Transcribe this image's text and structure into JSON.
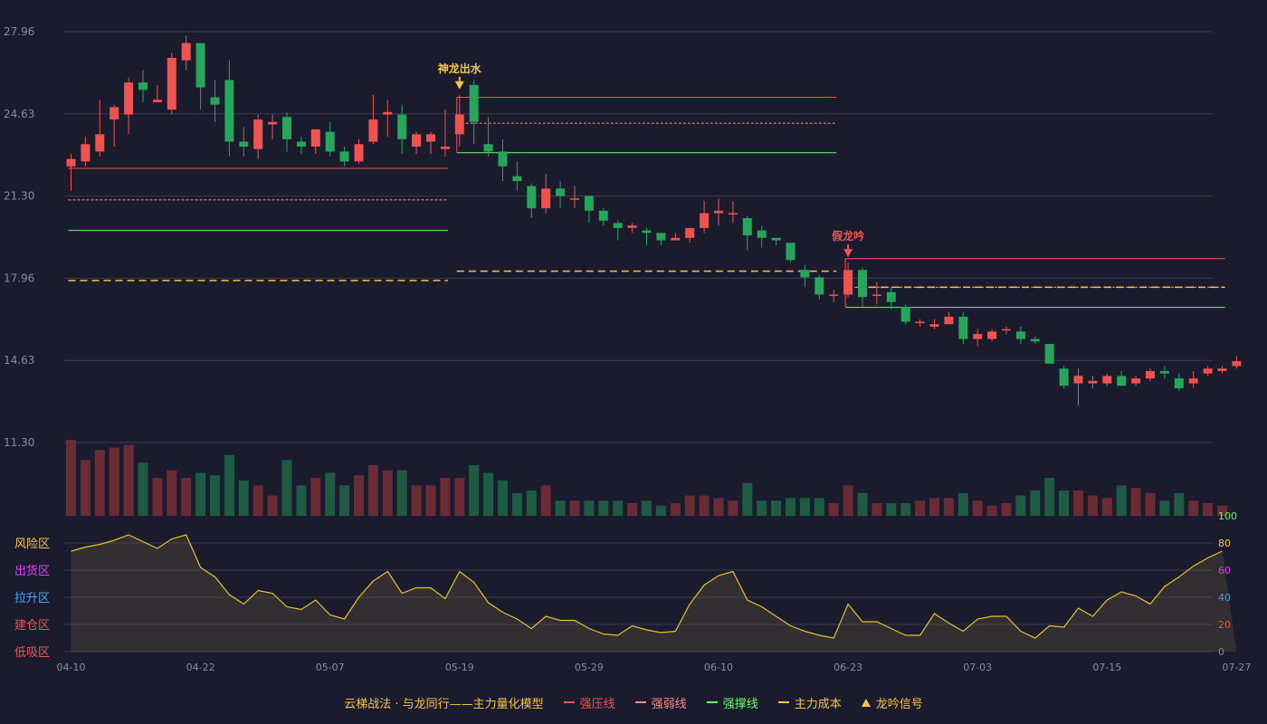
{
  "chart_data": {
    "type": "candlestick",
    "y_ticks": [
      "27.96",
      "24.63",
      "21.30",
      "17.96",
      "14.63",
      "11.30"
    ],
    "ylim": [
      11.3,
      27.96
    ],
    "x_ticks": [
      "04-10",
      "04-22",
      "05-07",
      "05-19",
      "05-29",
      "06-10",
      "06-23",
      "07-03",
      "07-15",
      "07-27"
    ],
    "candles": [
      [
        22.5,
        22.8,
        23.0,
        21.5
      ],
      [
        22.7,
        23.4,
        23.7,
        22.5
      ],
      [
        23.1,
        23.8,
        25.2,
        22.9
      ],
      [
        24.4,
        24.9,
        25.0,
        23.3
      ],
      [
        24.6,
        25.9,
        26.1,
        23.8
      ],
      [
        25.9,
        25.6,
        26.4,
        25.1
      ],
      [
        25.1,
        25.2,
        25.8,
        25.1
      ],
      [
        24.8,
        26.9,
        27.1,
        24.6
      ],
      [
        26.8,
        27.5,
        27.8,
        26.4
      ],
      [
        27.5,
        25.7,
        27.5,
        24.8
      ],
      [
        25.3,
        25.0,
        26.0,
        24.3
      ],
      [
        26.0,
        23.5,
        26.8,
        22.9
      ],
      [
        23.5,
        23.3,
        24.1,
        22.9
      ],
      [
        23.2,
        24.4,
        24.6,
        22.8
      ],
      [
        24.2,
        24.3,
        24.6,
        23.6
      ],
      [
        24.5,
        23.6,
        24.7,
        23.1
      ],
      [
        23.5,
        23.3,
        23.7,
        23.0
      ],
      [
        23.3,
        24.0,
        24.0,
        23.0
      ],
      [
        23.9,
        23.1,
        24.3,
        22.9
      ],
      [
        23.1,
        22.7,
        23.3,
        22.5
      ],
      [
        22.7,
        23.4,
        23.6,
        22.6
      ],
      [
        23.5,
        24.4,
        25.4,
        23.4
      ],
      [
        24.6,
        24.7,
        25.2,
        23.7
      ],
      [
        24.6,
        23.6,
        25.0,
        23.0
      ],
      [
        23.3,
        23.8,
        23.9,
        23.0
      ],
      [
        23.5,
        23.8,
        23.9,
        23.0
      ],
      [
        23.2,
        23.3,
        24.8,
        22.9
      ],
      [
        23.8,
        24.6,
        25.4,
        23.3
      ],
      [
        25.8,
        24.3,
        26.0,
        23.4
      ],
      [
        23.4,
        23.1,
        24.5,
        22.9
      ],
      [
        23.1,
        22.5,
        23.6,
        21.9
      ],
      [
        22.1,
        21.9,
        22.7,
        21.5
      ],
      [
        21.7,
        20.8,
        21.8,
        20.4
      ],
      [
        20.8,
        21.6,
        22.2,
        20.6
      ],
      [
        21.6,
        21.3,
        21.9,
        20.8
      ],
      [
        21.2,
        21.2,
        21.7,
        20.8
      ],
      [
        21.3,
        20.7,
        21.3,
        20.2
      ],
      [
        20.7,
        20.3,
        20.8,
        20.1
      ],
      [
        20.2,
        20.0,
        20.3,
        19.5
      ],
      [
        20.0,
        20.1,
        20.2,
        19.8
      ],
      [
        19.9,
        19.8,
        20.0,
        19.3
      ],
      [
        19.8,
        19.5,
        19.8,
        19.3
      ],
      [
        19.5,
        19.6,
        19.8,
        19.5
      ],
      [
        19.6,
        20.0,
        20.0,
        19.4
      ],
      [
        20.0,
        20.6,
        21.1,
        19.8
      ],
      [
        20.6,
        20.7,
        21.2,
        20.1
      ],
      [
        20.6,
        20.6,
        21.1,
        20.2
      ],
      [
        20.4,
        19.7,
        20.5,
        19.1
      ],
      [
        19.9,
        19.6,
        20.1,
        19.2
      ],
      [
        19.6,
        19.5,
        19.6,
        19.3
      ],
      [
        19.4,
        18.7,
        19.4,
        18.6
      ],
      [
        18.3,
        18.0,
        18.5,
        17.6
      ],
      [
        18.0,
        17.3,
        18.1,
        17.1
      ],
      [
        17.3,
        17.3,
        17.5,
        17.0
      ],
      [
        17.3,
        18.3,
        18.6,
        17.2
      ],
      [
        18.3,
        17.2,
        18.4,
        16.8
      ],
      [
        17.3,
        17.3,
        17.8,
        16.9
      ],
      [
        17.4,
        17.0,
        17.6,
        16.7
      ],
      [
        16.8,
        16.2,
        16.9,
        16.1
      ],
      [
        16.2,
        16.2,
        16.3,
        16.0
      ],
      [
        16.0,
        16.1,
        16.3,
        15.9
      ],
      [
        16.1,
        16.4,
        16.6,
        16.1
      ],
      [
        16.4,
        15.5,
        16.6,
        15.3
      ],
      [
        15.5,
        15.7,
        15.9,
        15.2
      ],
      [
        15.5,
        15.8,
        15.9,
        15.4
      ],
      [
        15.9,
        15.9,
        16.0,
        15.7
      ],
      [
        15.8,
        15.5,
        16.0,
        15.3
      ],
      [
        15.5,
        15.4,
        15.6,
        15.3
      ],
      [
        15.3,
        14.5,
        15.3,
        14.5
      ],
      [
        14.3,
        13.6,
        14.4,
        13.5
      ],
      [
        13.7,
        14.0,
        14.3,
        12.8
      ],
      [
        13.7,
        13.8,
        14.0,
        13.5
      ],
      [
        13.7,
        14.0,
        14.1,
        13.6
      ],
      [
        14.0,
        13.6,
        14.2,
        13.6
      ],
      [
        13.7,
        13.9,
        14.0,
        13.6
      ],
      [
        13.9,
        14.2,
        14.3,
        13.8
      ],
      [
        14.2,
        14.1,
        14.4,
        13.9
      ],
      [
        13.9,
        13.5,
        14.1,
        13.4
      ],
      [
        13.7,
        13.9,
        14.2,
        13.5
      ],
      [
        14.1,
        14.3,
        14.4,
        14.0
      ],
      [
        14.2,
        14.3,
        14.4,
        14.1
      ],
      [
        14.4,
        14.6,
        14.8,
        14.3
      ]
    ],
    "volumes": [
      30,
      22,
      26,
      27,
      28,
      21,
      15,
      18,
      15,
      17,
      16,
      24,
      14,
      12,
      8,
      22,
      12,
      15,
      17,
      12,
      16,
      20,
      18,
      18,
      12,
      12,
      15,
      15,
      20,
      17,
      14,
      9,
      10,
      12,
      6,
      6,
      6,
      6,
      6,
      5,
      6,
      4,
      5,
      8,
      8,
      7,
      6,
      13,
      6,
      6,
      7,
      7,
      7,
      5,
      12,
      9,
      5,
      5,
      5,
      6,
      7,
      7,
      9,
      6,
      4,
      5,
      8,
      10,
      15,
      10,
      10,
      8,
      7,
      12,
      11,
      9,
      6,
      9,
      6,
      5,
      4
    ],
    "indicator": [
      74,
      77,
      79,
      82,
      86,
      81,
      76,
      83,
      86,
      62,
      55,
      42,
      35,
      45,
      43,
      33,
      31,
      38,
      27,
      24,
      40,
      52,
      59,
      43,
      47,
      47,
      39,
      59,
      51,
      36,
      29,
      24,
      17,
      26,
      23,
      23,
      17,
      13,
      12,
      19,
      16,
      14,
      15,
      35,
      49,
      56,
      59,
      38,
      33,
      26,
      19,
      15,
      12,
      10,
      35,
      22,
      22,
      17,
      12,
      12,
      28,
      21,
      15,
      24,
      26,
      26,
      15,
      10,
      19,
      18,
      32,
      26,
      38,
      44,
      41,
      35,
      48,
      55,
      63,
      69,
      74
    ],
    "indicator_ticks": [
      "100",
      "80",
      "60",
      "40",
      "20",
      "0"
    ],
    "indicator_zones": [
      "风险区",
      "出货区",
      "拉升区",
      "建仓区",
      "低吸区"
    ],
    "annotations": [
      {
        "label": "神龙出水",
        "index": 27,
        "color": "#f5c542"
      },
      {
        "label": "假龙吟",
        "index": 54,
        "color": "#ef5350"
      }
    ],
    "levels": [
      {
        "from": 0,
        "to": 26,
        "resistance": 22.42,
        "weak": 21.14,
        "support": 19.9,
        "cost": 17.87
      },
      {
        "from": 27,
        "to": 53,
        "resistance": 25.3,
        "weak": 24.25,
        "support": 23.05,
        "cost": 18.25
      },
      {
        "from": 54,
        "to": 80,
        "resistance": 18.76,
        "weak": 17.6,
        "support": 16.78,
        "cost": 17.6
      }
    ],
    "legend": [
      {
        "label": "强压线",
        "color": "#ef5350",
        "style": "solid"
      },
      {
        "label": "强弱线",
        "color": "#ff8a8a",
        "style": "dash"
      },
      {
        "label": "强撑线",
        "color": "#66ff66",
        "style": "solid"
      },
      {
        "label": "主力成本",
        "color": "#f5c542",
        "style": "dash"
      },
      {
        "label": "龙吟信号",
        "color": "#f5c542",
        "style": "triangle"
      }
    ],
    "colors": {
      "up": "#ef5350",
      "down": "#26a65b",
      "grid": "#3a3a50",
      "axis_text": "#8a8a9a",
      "indicator_line": "#e6c229"
    }
  },
  "footer_title": "云梯战法 · 与龙同行——主力量化模型"
}
